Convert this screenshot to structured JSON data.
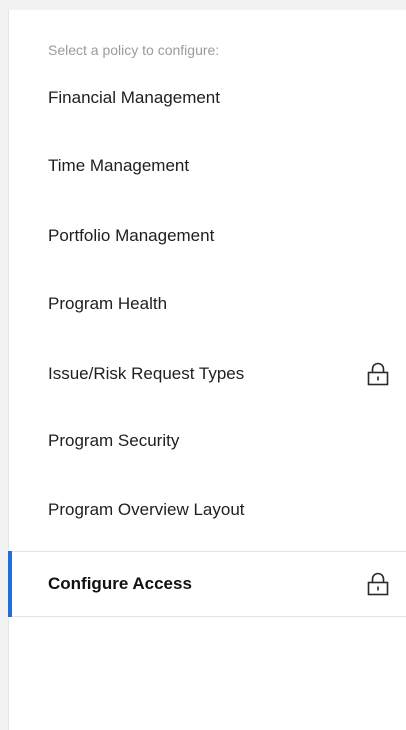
{
  "policy_panel": {
    "header": "Select a policy to configure:",
    "items": [
      {
        "label": "Financial Management",
        "locked": false,
        "selected": false
      },
      {
        "label": "Time Management",
        "locked": false,
        "selected": false
      },
      {
        "label": "Portfolio Management",
        "locked": false,
        "selected": false
      },
      {
        "label": "Program Health",
        "locked": false,
        "selected": false
      },
      {
        "label": "Issue/Risk Request Types",
        "locked": true,
        "selected": false,
        "icon": "lock-icon"
      },
      {
        "label": "Program Security",
        "locked": false,
        "selected": false
      },
      {
        "label": "Program Overview Layout",
        "locked": false,
        "selected": false
      },
      {
        "label": "Configure Access",
        "locked": true,
        "selected": true,
        "icon": "lock-icon"
      }
    ],
    "colors": {
      "accent": "#1f6fd6",
      "text": "#202020",
      "muted_text": "#9b9b9b",
      "background": "#ffffff"
    }
  }
}
